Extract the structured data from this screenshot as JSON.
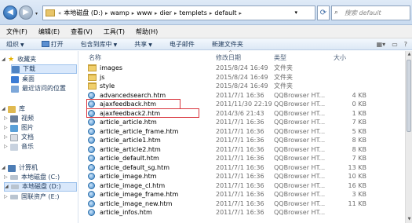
{
  "address": {
    "recent_arrow": "▾",
    "crumbs": [
      "本地磁盘 (D:)",
      "wamp",
      "www",
      "dier",
      "templets",
      "default"
    ],
    "search_placeholder": "搜索 default"
  },
  "menu": [
    "文件(F)",
    "编辑(E)",
    "查看(V)",
    "工具(T)",
    "帮助(H)"
  ],
  "toolbar": {
    "organize": "组织",
    "open": "打开",
    "include": "包含到库中",
    "share": "共享",
    "email": "电子邮件",
    "new_folder": "新建文件夹"
  },
  "nav": {
    "favorites": "收藏夹",
    "downloads": "下载",
    "desktop": "桌面",
    "recent": "最近访问的位置",
    "libraries": "库",
    "videos": "视频",
    "pictures": "图片",
    "documents": "文档",
    "music": "音乐",
    "computer": "计算机",
    "drive_c": "本地磁盘 (C:)",
    "drive_d": "本地磁盘 (D:)",
    "drive_e": "国联资产 (E:)"
  },
  "columns": {
    "name": "名称",
    "date": "修改日期",
    "type": "类型",
    "size": "大小"
  },
  "files": [
    {
      "name": "images",
      "date": "2015/8/24 16:49",
      "type": "文件夹",
      "size": "",
      "kind": "folder"
    },
    {
      "name": "js",
      "date": "2015/8/24 16:49",
      "type": "文件夹",
      "size": "",
      "kind": "folder"
    },
    {
      "name": "style",
      "date": "2015/8/24 16:49",
      "type": "文件夹",
      "size": "",
      "kind": "folder"
    },
    {
      "name": "advancedsearch.htm",
      "date": "2011/7/1 16:36",
      "type": "QQBrowser HT...",
      "size": "4 KB",
      "kind": "page"
    },
    {
      "name": "ajaxfeedback.htm",
      "date": "2011/11/30 22:19",
      "type": "QQBrowser HT...",
      "size": "0 KB",
      "kind": "page",
      "highlight": true
    },
    {
      "name": "ajaxfeedback2.htm",
      "date": "2014/3/6 21:43",
      "type": "QQBrowser HT...",
      "size": "1 KB",
      "kind": "page",
      "highlight": true
    },
    {
      "name": "article_article.htm",
      "date": "2011/7/1 16:36",
      "type": "QQBrowser HT...",
      "size": "7 KB",
      "kind": "page"
    },
    {
      "name": "article_article_frame.htm",
      "date": "2011/7/1 16:36",
      "type": "QQBrowser HT...",
      "size": "5 KB",
      "kind": "page"
    },
    {
      "name": "article_article1.htm",
      "date": "2011/7/1 16:36",
      "type": "QQBrowser HT...",
      "size": "8 KB",
      "kind": "page"
    },
    {
      "name": "article_article2.htm",
      "date": "2011/7/1 16:36",
      "type": "QQBrowser HT...",
      "size": "8 KB",
      "kind": "page"
    },
    {
      "name": "article_default.htm",
      "date": "2011/7/1 16:36",
      "type": "QQBrowser HT...",
      "size": "7 KB",
      "kind": "page"
    },
    {
      "name": "article_default_sg.htm",
      "date": "2011/7/1 16:36",
      "type": "QQBrowser HT...",
      "size": "13 KB",
      "kind": "page"
    },
    {
      "name": "article_image.htm",
      "date": "2011/7/1 16:36",
      "type": "QQBrowser HT...",
      "size": "10 KB",
      "kind": "page"
    },
    {
      "name": "article_image_cl.htm",
      "date": "2011/7/1 16:36",
      "type": "QQBrowser HT...",
      "size": "16 KB",
      "kind": "page"
    },
    {
      "name": "article_image_frame.htm",
      "date": "2011/7/1 16:36",
      "type": "QQBrowser HT...",
      "size": "3 KB",
      "kind": "page"
    },
    {
      "name": "article_image_new.htm",
      "date": "2011/7/1 16:36",
      "type": "QQBrowser HT...",
      "size": "11 KB",
      "kind": "page"
    },
    {
      "name": "article_infos.htm",
      "date": "2011/7/1 16:36",
      "type": "QQBrowser HT...",
      "size": "",
      "kind": "page"
    }
  ],
  "colors": {
    "highlight_border": "#d9363e",
    "selected_bg": "#d9e8fb"
  }
}
